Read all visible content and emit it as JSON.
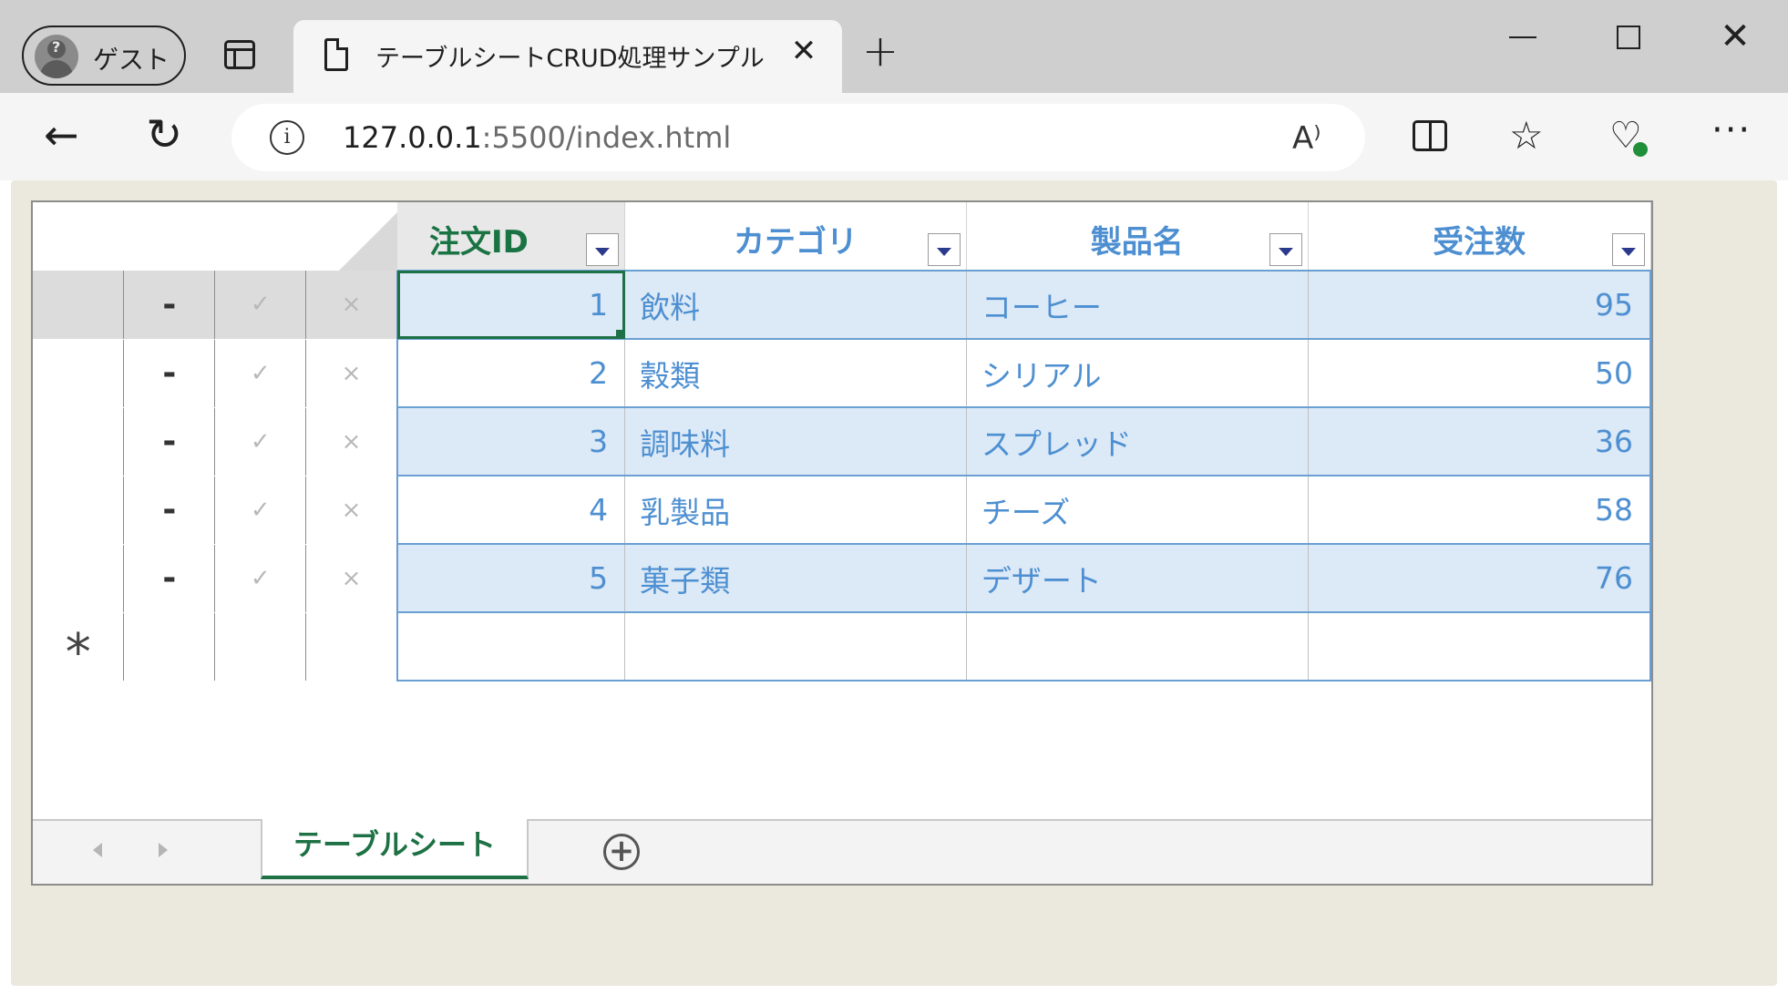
{
  "browser": {
    "profile_label": "ゲスト",
    "tab_title": "テーブルシートCRUD処理サンプル",
    "url_host": "127.0.0.1",
    "url_rest": ":5500/index.html"
  },
  "grid": {
    "columns": [
      {
        "label": "注文ID"
      },
      {
        "label": "カテゴリ"
      },
      {
        "label": "製品名"
      },
      {
        "label": "受注数"
      }
    ],
    "row_actions": {
      "minus": "-",
      "check": "✓",
      "cross": "×",
      "new_row": "*"
    },
    "rows": [
      {
        "id": "1",
        "category": "飲料",
        "product": "コーヒー",
        "qty": "95"
      },
      {
        "id": "2",
        "category": "穀類",
        "product": "シリアル",
        "qty": "50"
      },
      {
        "id": "3",
        "category": "調味料",
        "product": "スプレッド",
        "qty": "36"
      },
      {
        "id": "4",
        "category": "乳製品",
        "product": "チーズ",
        "qty": "58"
      },
      {
        "id": "5",
        "category": "菓子類",
        "product": "デザート",
        "qty": "76"
      }
    ],
    "active_cell": {
      "row": 1,
      "column": "注文ID"
    }
  },
  "sheet_tabs": {
    "active_tab": "テーブルシート",
    "add_label": "+"
  }
}
